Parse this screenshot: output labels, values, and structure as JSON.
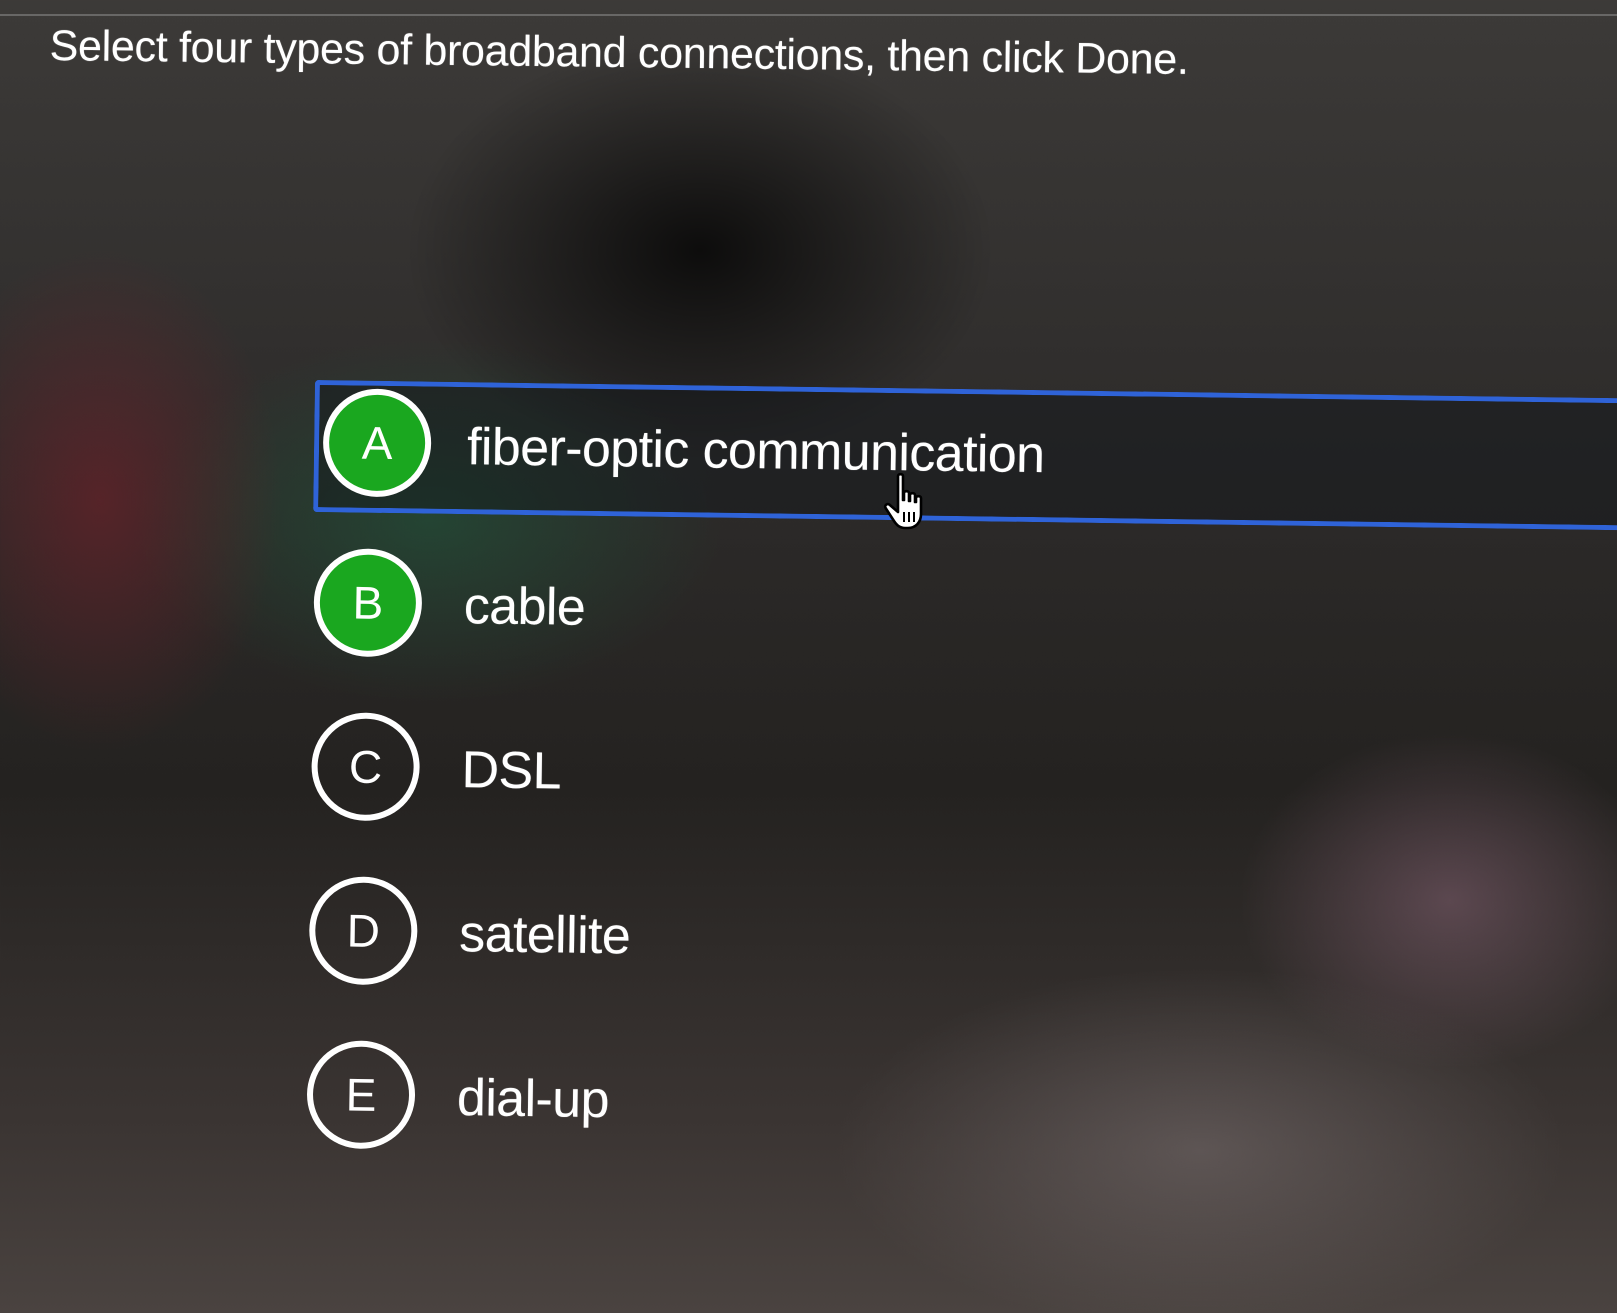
{
  "prompt": "Select four types of broadband connections, then click Done.",
  "options": [
    {
      "letter": "A",
      "label": "fiber-optic communication",
      "selected": true,
      "focused": true
    },
    {
      "letter": "B",
      "label": "cable",
      "selected": true,
      "focused": false
    },
    {
      "letter": "C",
      "label": "DSL",
      "selected": false,
      "focused": false
    },
    {
      "letter": "D",
      "label": "satellite",
      "selected": false,
      "focused": false
    },
    {
      "letter": "E",
      "label": "dial-up",
      "selected": false,
      "focused": false
    }
  ],
  "colors": {
    "selected_badge": "#1aa71f",
    "focus_border": "#2f63d8",
    "text": "#ffffff"
  },
  "cursor_icon": "hand-pointer-icon"
}
